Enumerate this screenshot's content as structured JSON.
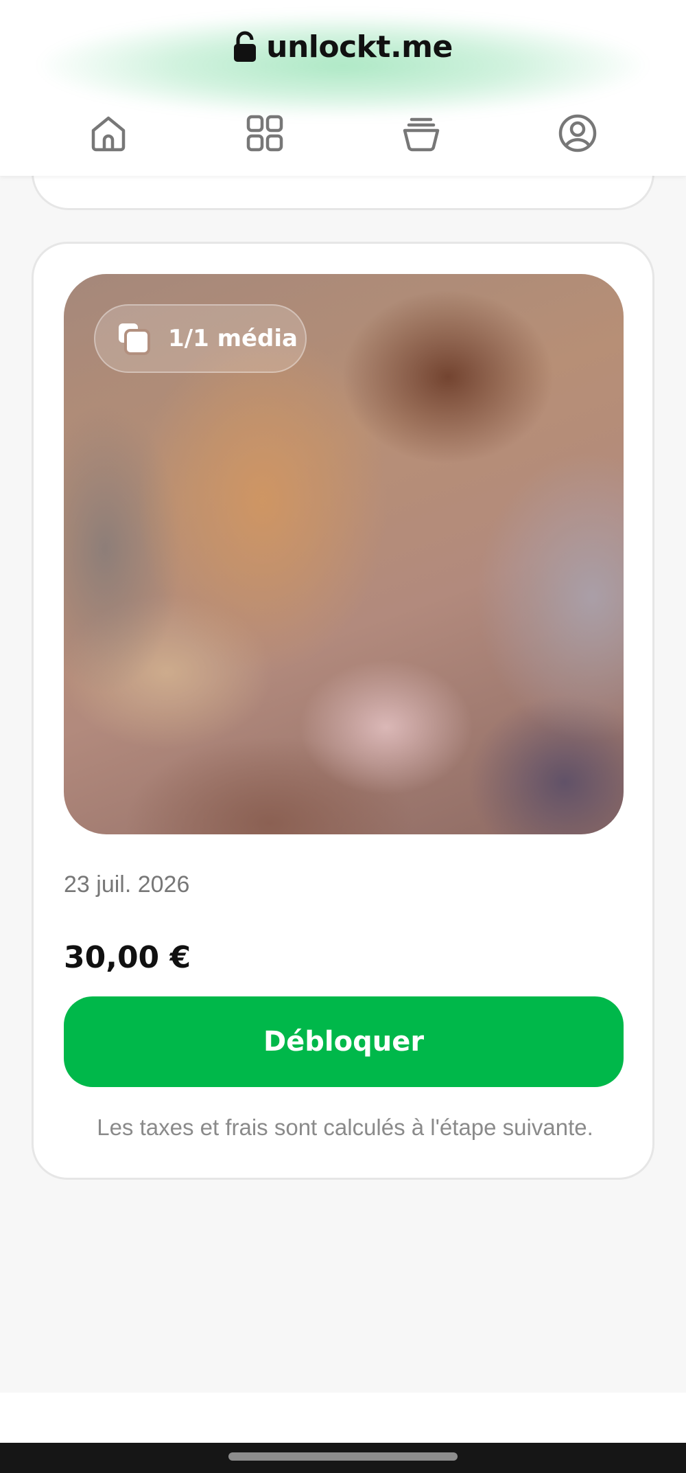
{
  "header": {
    "site_name": "unlockt.me",
    "brand_icon": "lock-icon",
    "nav": [
      {
        "name": "home",
        "icon": "home-icon"
      },
      {
        "name": "grid",
        "icon": "grid-icon"
      },
      {
        "name": "bucket",
        "icon": "bucket-icon"
      },
      {
        "name": "profile",
        "icon": "profile-icon"
      }
    ]
  },
  "post": {
    "media_count_label": "1/1 média",
    "media_icon": "media-stack-icon",
    "date": "23 juil. 2026",
    "price": "30,00 €",
    "unlock_label": "Débloquer",
    "tax_note": "Les taxes et frais sont calculés à l'étape suivante."
  },
  "colors": {
    "accent": "#00b84a",
    "text": "#111111",
    "muted": "#8a8a8a",
    "background": "#f7f7f7"
  }
}
